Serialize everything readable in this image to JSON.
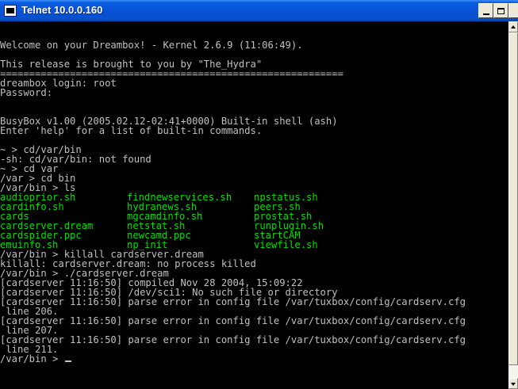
{
  "window": {
    "title": "Telnet 10.0.0.160"
  },
  "icons": {
    "app": "telnet-app-icon",
    "minimize": "minimize-icon",
    "maximize": "maximize-icon",
    "close": "close-icon",
    "cursor": "text-cursor"
  },
  "colors": {
    "titlebar": "#0852d6",
    "terminal_bg": "#000000",
    "text": "#c0c0c0",
    "listing": "#00e000"
  },
  "terminal": {
    "header_lines": [
      "Welcome on your Dreambox! - Kernel 2.6.9 (11:06:49).",
      "",
      "This release is brought to you by \"The_Hydra\"",
      "===========================================================",
      "dreambox login: root",
      "Password:",
      "",
      "",
      "BusyBox v1.00 (2005.02.12-02:41+0000) Built-in shell (ash)",
      "Enter 'help' for a list of built-in commands.",
      "",
      "~ > cd/var/bin",
      "-sh: cd/var/bin: not found",
      "~ > cd var",
      "/var > cd bin",
      "/var/bin > ls"
    ],
    "listing": [
      [
        "audioprior.sh",
        "findnewservices.sh",
        "npstatus.sh"
      ],
      [
        "cardinfo.sh",
        "hydranews.sh",
        "peers.sh"
      ],
      [
        "cards",
        "mgcamdinfo.sh",
        "prostat.sh"
      ],
      [
        "cardserver.dream",
        "netstat.sh",
        "runplugin.sh"
      ],
      [
        "cardspider.ppc",
        "newcamd.ppc",
        "startCAM"
      ],
      [
        "emuinfo.sh",
        "np_init",
        "viewfile.sh"
      ]
    ],
    "footer_lines": [
      "/var/bin > killall cardserver.dream",
      "killall: cardserver.dream: no process killed",
      "/var/bin > ./cardserver.dream",
      "[cardserver 11:16:50] compiled Nov 28 2004, 15:09:22",
      "[cardserver 11:16:50] /dev/sci1: No such file or directory",
      "[cardserver 11:16:50] parse error in config file /var/tuxbox/config/cardserv.cfg",
      " line 206.",
      "[cardserver 11:16:50] parse error in config file /var/tuxbox/config/cardserv.cfg",
      " line 207.",
      "[cardserver 11:16:50] parse error in config file /var/tuxbox/config/cardserv.cfg",
      " line 211."
    ],
    "prompt": "/var/bin > "
  }
}
